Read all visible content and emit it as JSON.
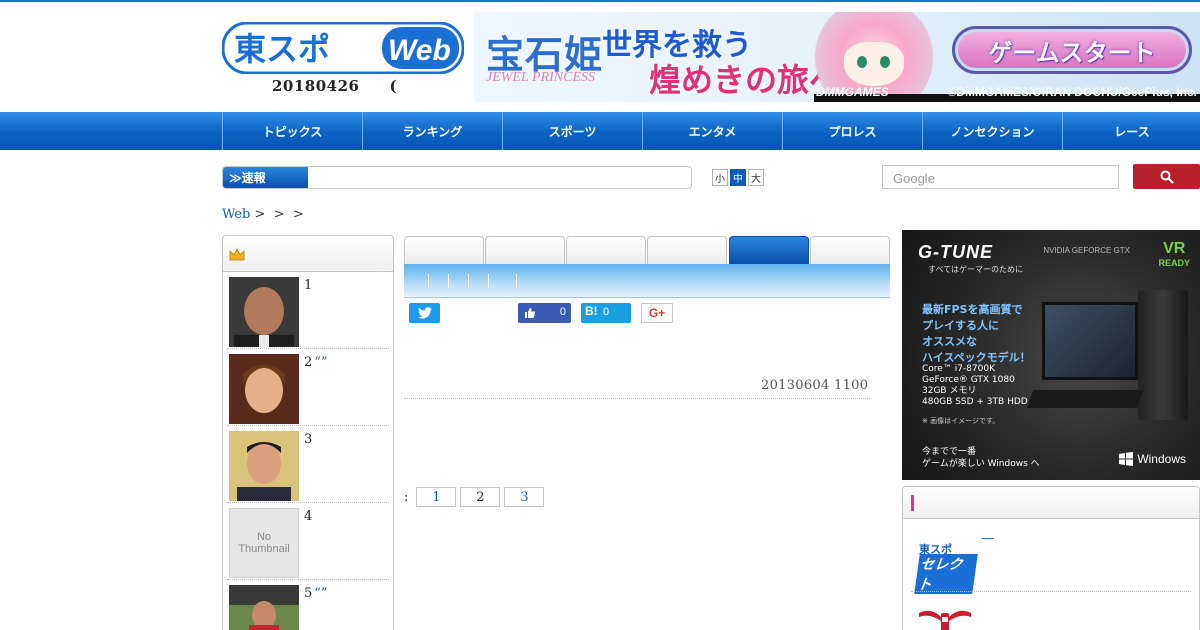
{
  "header": {
    "logo_main": "東スポ",
    "logo_sub": "Web",
    "date": "20180426",
    "date_paren": "("
  },
  "banner": {
    "title": "宝石姫",
    "subtitle": "JEWEL PRINCESS",
    "catch1": "世界を救う",
    "catch2": "煌めきの旅へ",
    "button": "ゲームスタート",
    "maker": "DMMGAMES",
    "copyright": "©DMMGAMES/OIRAN DOCHU/GeePlus, Inc."
  },
  "nav": {
    "items": [
      "トピックス",
      "ランキング",
      "スポーツ",
      "エンタメ",
      "プロレス",
      "ノンセクション",
      "レース"
    ]
  },
  "sokuho": {
    "label": "≫速報"
  },
  "fontsize": {
    "small": "小",
    "medium": "中",
    "large": "大"
  },
  "search": {
    "placeholder": "Google"
  },
  "breadcrumb": {
    "home": "Web",
    "sep1": ">",
    "sep2": ">",
    "sep3": ">"
  },
  "ranking": {
    "items": [
      {
        "rank": "1",
        "quote": ""
      },
      {
        "rank": "2",
        "quote": "“”"
      },
      {
        "rank": "3",
        "quote": ""
      },
      {
        "rank": "4",
        "quote": ""
      },
      {
        "rank": "5",
        "quote": "“”"
      }
    ],
    "no_thumb_line1": "No",
    "no_thumb_line2": "Thumbnail"
  },
  "share": {
    "like_count": "0",
    "hatena_label": "B!",
    "hatena_count": "0",
    "gplus_label": "G+"
  },
  "article": {
    "timestamp": "20130604 1100"
  },
  "pager": {
    "colon": ":",
    "pages": [
      "1",
      "2",
      "3"
    ],
    "current": "2"
  },
  "ad_gtune": {
    "brand": "G-TUNE",
    "brand_sub": "すべてはゲーマーのために",
    "nvidia": "NVIDIA GEFORCE GTX",
    "vr": "VR",
    "vr_sub": "READY",
    "headline_lines": [
      "最新FPSを高画質で",
      "プレイする人に",
      "オススメな",
      "ハイスペックモデル！"
    ],
    "spec_lines": [
      "Core™ i7-8700K",
      "GeForce® GTX 1080",
      "32GB メモリ",
      "480GB SSD + 3TB HDD"
    ],
    "note": "※ 画像はイメージです。",
    "tagline_lines": [
      "今までで一番",
      "ゲームが楽しい Windows へ"
    ],
    "windows": "Windows"
  },
  "select_box": {
    "logo_top": "東スポ",
    "logo_bottom": "セレクト",
    "dash": "—"
  },
  "colors": {
    "nav_blue": "#0b62c4",
    "accent_red": "#b8202c",
    "link_blue": "#1a5fa8"
  }
}
